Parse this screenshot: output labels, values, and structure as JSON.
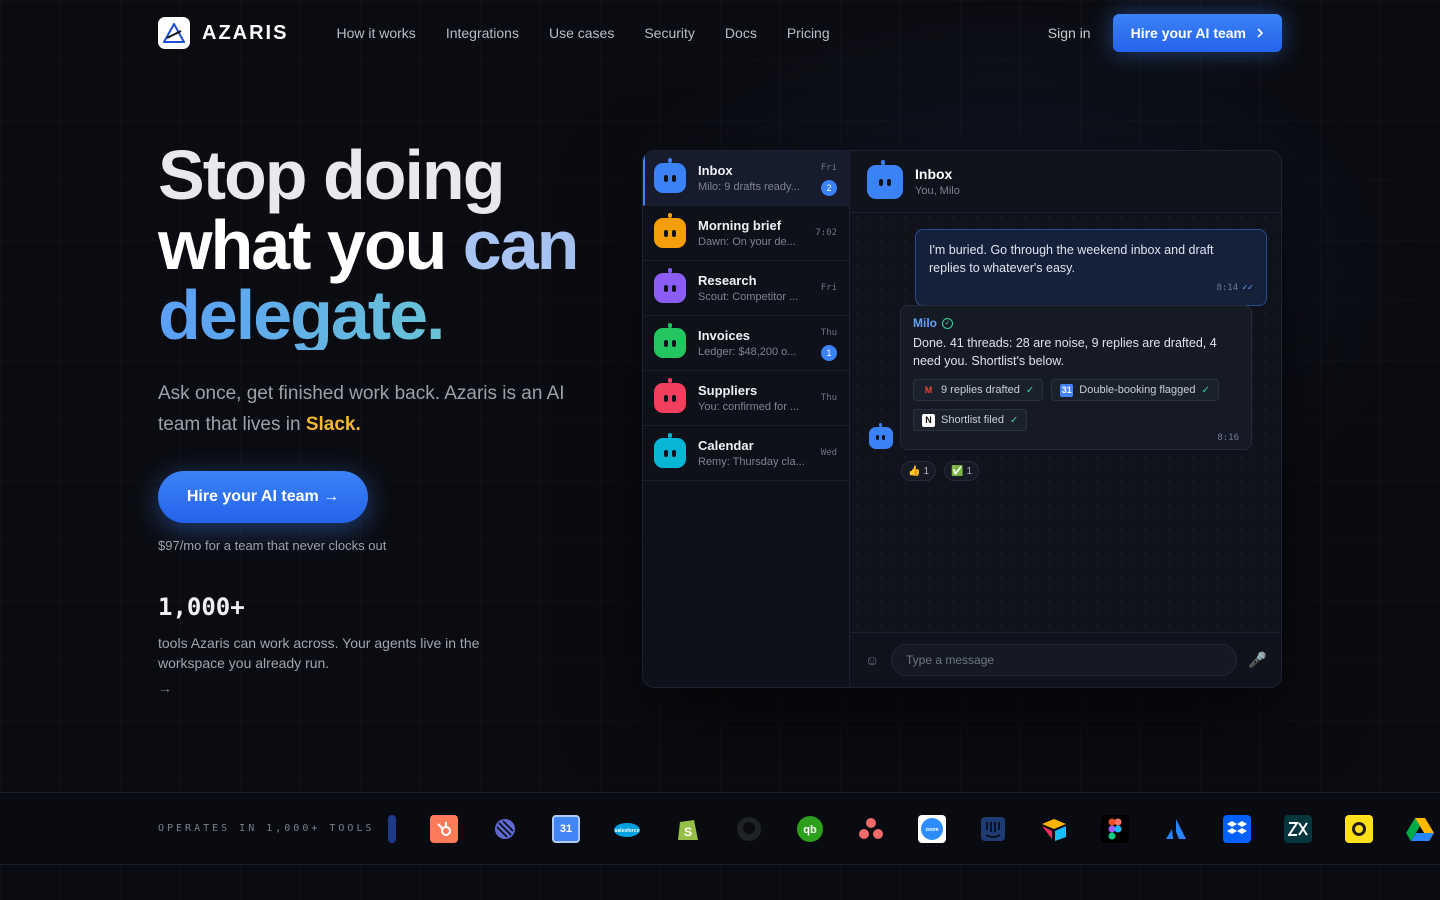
{
  "nav": {
    "brand": "AZARIS",
    "links": [
      "How it works",
      "Integrations",
      "Use cases",
      "Security",
      "Docs",
      "Pricing"
    ],
    "signin": "Sign in",
    "cta": "Hire your AI team",
    "cta_icon": "chevron-right-icon"
  },
  "hero": {
    "line1": "Stop doing",
    "line2a": "what you ",
    "line2b": "can",
    "line3": "delegate.",
    "subtitle": "Ask once, get finished work back. Azaris is an AI team that lives in ",
    "subtitle_highlight": "Slack.",
    "cta": "Hire your AI team →",
    "price": "$97/mo for a team that never clocks out",
    "stat_number": "1,000+",
    "stat_desc": "tools Azaris can work across. Your agents live in the workspace you already run.",
    "stat_arrow": "→"
  },
  "chat": {
    "conversations": [
      {
        "title": "Inbox",
        "sub": "Milo: 9 drafts ready...",
        "time": "Fri",
        "badge": "2",
        "color": "#3b82f6"
      },
      {
        "title": "Morning brief",
        "sub": "Dawn: On your de...",
        "time": "7:02",
        "badge": "",
        "color": "#f59e0b"
      },
      {
        "title": "Research",
        "sub": "Scout: Competitor ...",
        "time": "Fri",
        "badge": "",
        "color": "#8b5cf6"
      },
      {
        "title": "Invoices",
        "sub": "Ledger: $48,200 o...",
        "time": "Thu",
        "badge": "1",
        "color": "#22c55e"
      },
      {
        "title": "Suppliers",
        "sub": "You: confirmed for ...",
        "time": "Thu",
        "badge": "",
        "color": "#f43f5e"
      },
      {
        "title": "Calendar",
        "sub": "Remy: Thursday cla...",
        "time": "Wed",
        "badge": "",
        "color": "#06b6d4"
      }
    ],
    "header_title": "Inbox",
    "header_sub": "You, Milo",
    "outgoing": {
      "text": "I'm buried. Go through the weekend inbox and draft replies to whatever's easy.",
      "time": "8:14",
      "tick": "✓✓"
    },
    "incoming": {
      "sender": "Milo",
      "text": "Done. 41 threads: 28 are noise, 9 replies are drafted, 4 need you. Shortlist's below.",
      "time": "8:16",
      "chips": [
        {
          "label": "9 replies drafted",
          "icon": "gmail-icon"
        },
        {
          "label": "Double-booking flagged",
          "icon": "google-calendar-icon"
        },
        {
          "label": "Shortlist filed",
          "icon": "notion-icon"
        }
      ]
    },
    "reactions": [
      {
        "emoji": "👍",
        "count": "1"
      },
      {
        "emoji": "✅",
        "count": "1"
      }
    ],
    "composer_placeholder": "Type a message"
  },
  "tools": {
    "label": "OPERATES IN 1,000+ TOOLS",
    "icons": [
      "hubspot-icon",
      "linear-icon",
      "google-calendar-icon",
      "salesforce-icon",
      "shopify-icon",
      "github-icon",
      "quickbooks-icon",
      "asana-icon",
      "zoom-icon",
      "intercom-icon",
      "airtable-icon",
      "figma-icon",
      "atlassian-icon",
      "dropbox-icon",
      "zendesk-icon",
      "mailchimp-icon",
      "google-drive-icon"
    ]
  }
}
